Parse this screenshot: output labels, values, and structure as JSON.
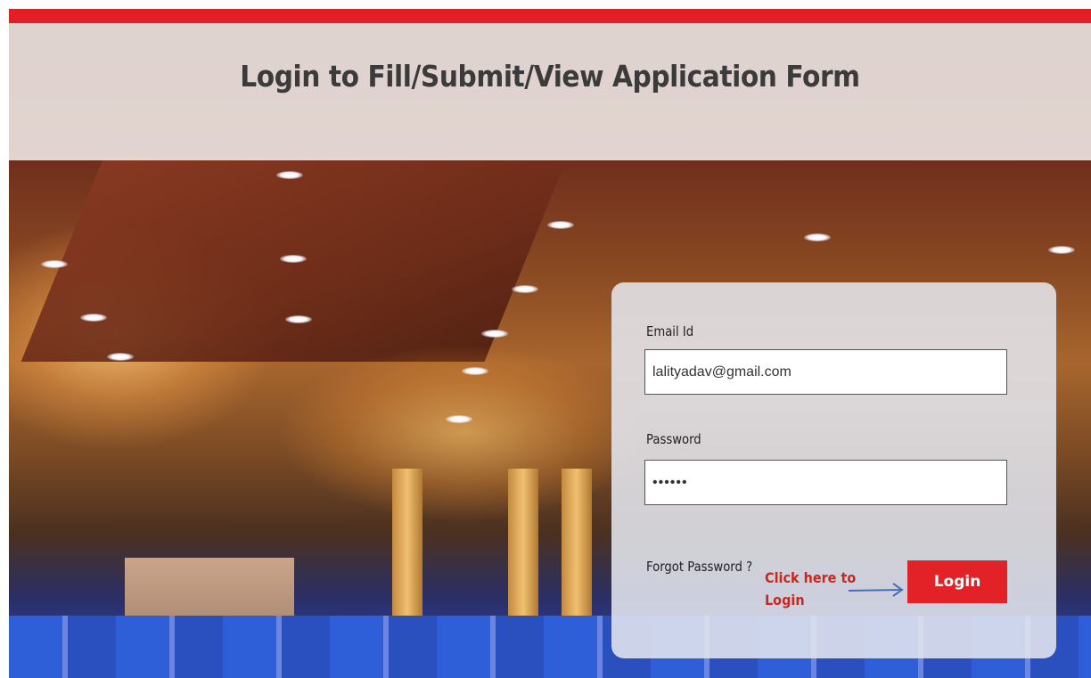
{
  "page": {
    "title": "Login to Fill/Submit/View Application Form",
    "accent_color": "#e31e24"
  },
  "login_form": {
    "email_label": "Email Id",
    "email_value": "lalityadav@gmail.com",
    "password_label": "Password",
    "password_value": "••••••",
    "forgot_password_label": "Forgot Password ?",
    "login_button_label": "Login",
    "button_color": "#e32228"
  },
  "annotation": {
    "hint_line1": "Click here to",
    "hint_line2": "Login",
    "arrow_icon": "arrow-right-icon",
    "hint_color": "#c8281e"
  }
}
